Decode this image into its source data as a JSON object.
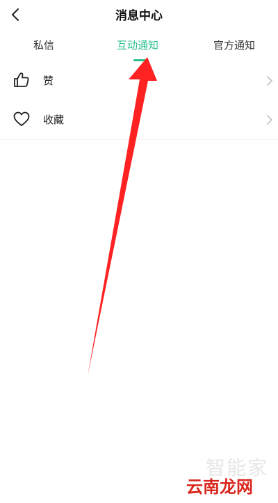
{
  "header": {
    "title": "消息中心",
    "back_icon": "chevron-left-icon"
  },
  "tabs": [
    {
      "label": "私信",
      "active": false
    },
    {
      "label": "互动通知",
      "active": true
    },
    {
      "label": "官方通知",
      "active": false
    }
  ],
  "list": [
    {
      "label": "赞",
      "icon": "thumbs-up-icon"
    },
    {
      "label": "收藏",
      "icon": "heart-icon"
    }
  ],
  "watermark": {
    "line1": "智能家",
    "line2": "云南龙网"
  },
  "colors": {
    "accent": "#2bbf8c",
    "arrow": "#ff2222",
    "watermark_red": "#d9261c"
  }
}
